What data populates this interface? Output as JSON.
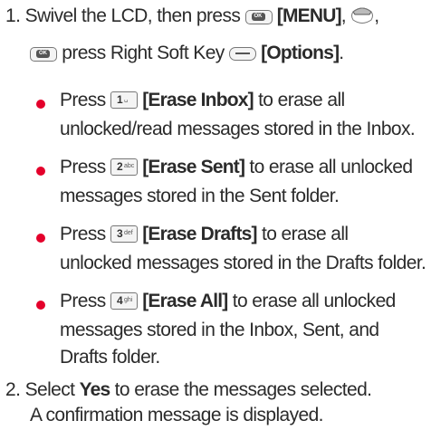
{
  "step1": {
    "number": "1.",
    "text_a": "Swivel the LCD, then press",
    "menu_label": "[MENU]",
    "text_b": ",",
    "text_c": ",",
    "text_d": "press Right Soft Key",
    "options_label": "[Options]",
    "text_e": "."
  },
  "keys": {
    "ok_glyph": "OK"
  },
  "bullets": [
    {
      "press": "Press",
      "key_digit": "1",
      "key_sub": "␣",
      "label": "[Erase Inbox]",
      "rest_line1": " to erase all",
      "line2": "unlocked/read messages stored in the Inbox."
    },
    {
      "press": "Press",
      "key_digit": "2",
      "key_sub": "abc",
      "label": "[Erase Sent]",
      "rest_line1": " to erase all unlocked",
      "line2": "messages stored in the Sent folder."
    },
    {
      "press": "Press",
      "key_digit": "3",
      "key_sub": "def",
      "label": "[Erase Drafts]",
      "rest_line1": " to erase all",
      "line2": "unlocked messages stored in the Drafts folder."
    },
    {
      "press": "Press",
      "key_digit": "4",
      "key_sub": "ghi",
      "label": "[Erase All]",
      "rest_line1": " to erase all unlocked",
      "line2": "messages stored in the Inbox, Sent, and",
      "line3": "Drafts folder."
    }
  ],
  "step2": {
    "number": "2.",
    "text_a": "Select",
    "yes_label": "Yes",
    "text_b": "to erase the messages selected.",
    "line2": "A confirmation message is displayed."
  },
  "colors": {
    "bullet": "#e4002b",
    "text": "#2b2b2b"
  }
}
